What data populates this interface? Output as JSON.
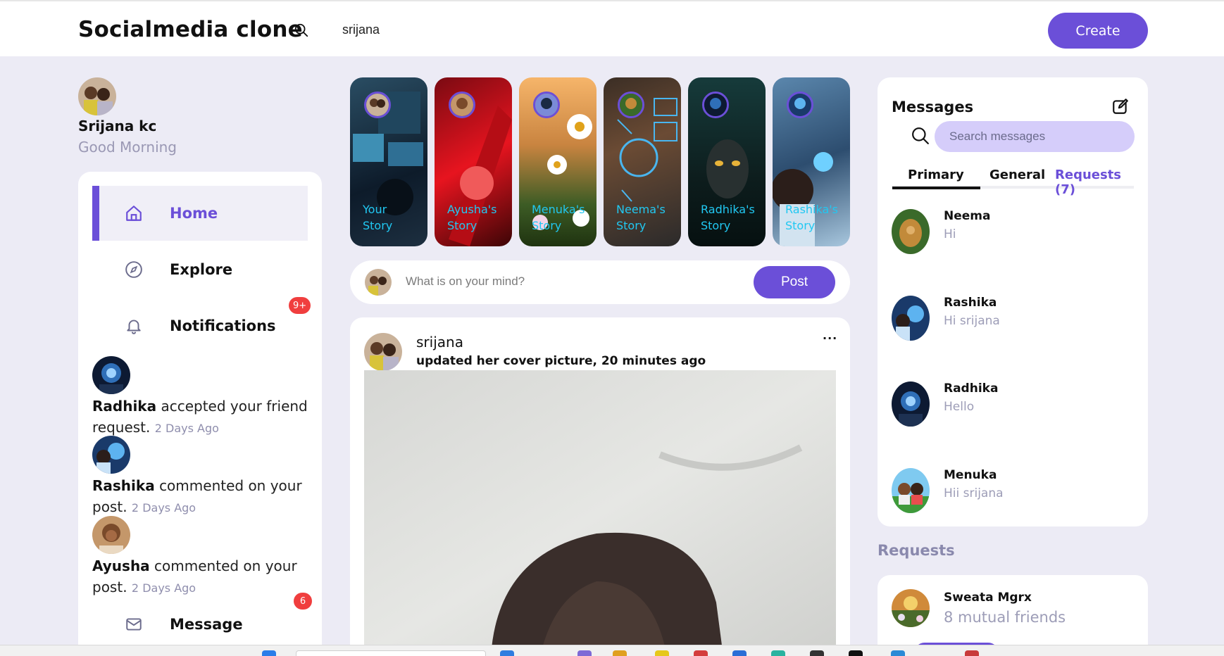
{
  "app": {
    "title": "Socialmedia clone",
    "search_value": "srijana",
    "create_label": "Create"
  },
  "profile": {
    "name": "Srijana kc",
    "greeting": "Good Morning"
  },
  "nav": {
    "items": [
      {
        "label": "Home",
        "icon": "home-icon",
        "active": true
      },
      {
        "label": "Explore",
        "icon": "compass-icon"
      },
      {
        "label": "Notifications",
        "icon": "bell-icon",
        "badge": "9+"
      },
      {
        "label": "Message",
        "icon": "mail-icon",
        "badge": "6"
      }
    ]
  },
  "notifications": [
    {
      "name": "Radhika",
      "text": "accepted your friend request.",
      "ago": "2 Days Ago"
    },
    {
      "name": "Rashika",
      "text": "commented on your post.",
      "ago": "2 Days Ago"
    },
    {
      "name": "Ayusha",
      "text": "commented on your post.",
      "ago": "2 Days Ago"
    }
  ],
  "stories": [
    {
      "l1": "Your",
      "l2": "Story"
    },
    {
      "l1": "Ayusha's",
      "l2": "Story"
    },
    {
      "l1": "Menuka's",
      "l2": "Story"
    },
    {
      "l1": "Neema's",
      "l2": "Story"
    },
    {
      "l1": "Radhika's",
      "l2": "Story"
    },
    {
      "l1": "Rashika's",
      "l2": "Story"
    }
  ],
  "composer": {
    "placeholder": "What is on your mind?",
    "post_label": "Post"
  },
  "feed": {
    "author": "srijana",
    "activity": "updated her cover picture, 20 minutes ago",
    "more": "···"
  },
  "messages": {
    "title": "Messages",
    "search_placeholder": "Search messages",
    "tabs": [
      "Primary",
      "General",
      "Requests (7)"
    ],
    "chats": [
      {
        "name": "Neema",
        "preview": "Hi"
      },
      {
        "name": "Rashika",
        "preview": "Hi srijana"
      },
      {
        "name": "Radhika",
        "preview": "Hello"
      },
      {
        "name": "Menuka",
        "preview": "Hii srijana"
      }
    ]
  },
  "requests": {
    "heading": "Requests",
    "items": [
      {
        "name": "Sweata Mgrx",
        "mutual": "8 mutual friends"
      }
    ]
  },
  "colors": {
    "accent": "#6b4fd8",
    "badge": "#f03e3e",
    "story_caption": "#21c8f2",
    "page_bg": "#ecebf5"
  }
}
